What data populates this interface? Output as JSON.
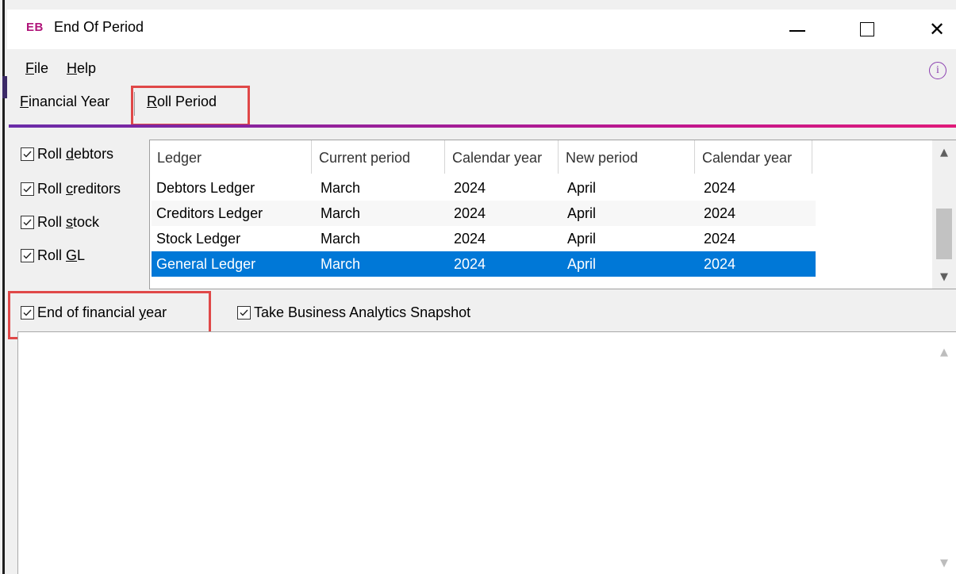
{
  "window": {
    "logo": "EB",
    "title": "End Of Period",
    "minimize_glyph": "—",
    "maximize_glyph": "",
    "close_glyph": "✕"
  },
  "menu": {
    "file": "File",
    "help": "Help",
    "info_glyph": "i"
  },
  "tabs": [
    {
      "label": "Financial Year",
      "active": false
    },
    {
      "label": "Roll Period",
      "active": true
    }
  ],
  "roll_options": [
    {
      "label": "Roll debtors",
      "checked": true
    },
    {
      "label": "Roll creditors",
      "checked": true
    },
    {
      "label": "Roll stock",
      "checked": true
    },
    {
      "label": "Roll GL",
      "checked": true
    }
  ],
  "grid": {
    "columns": [
      "Ledger",
      "Current period",
      "Calendar year",
      "New period",
      "Calendar year"
    ],
    "rows": [
      [
        "Debtors Ledger",
        "March",
        "2024",
        "April",
        "2024"
      ],
      [
        "Creditors Ledger",
        "March",
        "2024",
        "April",
        "2024"
      ],
      [
        "Stock Ledger",
        "March",
        "2024",
        "April",
        "2024"
      ],
      [
        "General Ledger",
        "March",
        "2024",
        "April",
        "2024"
      ]
    ],
    "selected_row": 3
  },
  "options": {
    "end_of_financial_year": {
      "label": "End of financial year",
      "checked": true
    },
    "snapshot": {
      "label": "Take Business Analytics Snapshot",
      "checked": true
    }
  },
  "scroll_arrows": {
    "up": "▲",
    "down": "▼"
  },
  "colors": {
    "accent_start": "#6a2ca8",
    "accent_end": "#e01b7a",
    "selection": "#0078d7",
    "highlight_box": "#e04848"
  }
}
